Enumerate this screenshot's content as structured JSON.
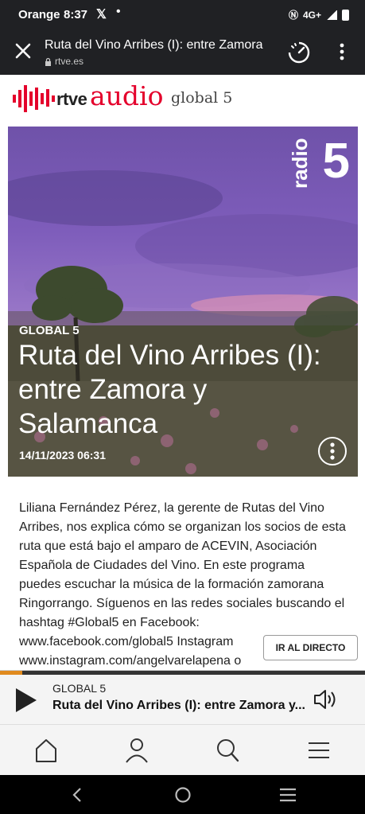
{
  "status": {
    "carrier": "Orange",
    "time": "8:37",
    "network": "4G+"
  },
  "browser": {
    "title": "Ruta del Vino Arribes (I): entre Zamora",
    "url": "rtve.es"
  },
  "brand": {
    "rtve": "rtve",
    "audio": "audio",
    "program": "global 5"
  },
  "hero": {
    "station": "5",
    "station_word": "radio",
    "section": "GLOBAL 5",
    "headline": "Ruta del Vino Arribes (I): entre Zamora y Salamanca",
    "date": "14/11/2023 06:31"
  },
  "description": "Liliana Fernández Pérez, la gerente de Rutas del Vino Arribes, nos explica cómo se organizan los socios de esta ruta que está bajo el amparo de ACEVIN, Asociación Española de Ciudades del Vino. En este programa puedes escuchar la música de la formación zamorana Ringorrango. Síguenos en las redes sociales buscando el hashtag #Global5 en Facebook: www.facebook.com/global5 Instagram www.instagram.com/angelvarelapena o",
  "live_button": "IR AL DIRECTO",
  "player": {
    "section": "GLOBAL 5",
    "title": "Ruta del Vino Arribes (I): entre Zamora y...",
    "progress": 0.06
  },
  "tabs": [
    "home-icon",
    "user-icon",
    "search-icon",
    "menu-icon"
  ],
  "colors": {
    "brand_red": "#e4002b",
    "progress": "#e08a1e"
  }
}
